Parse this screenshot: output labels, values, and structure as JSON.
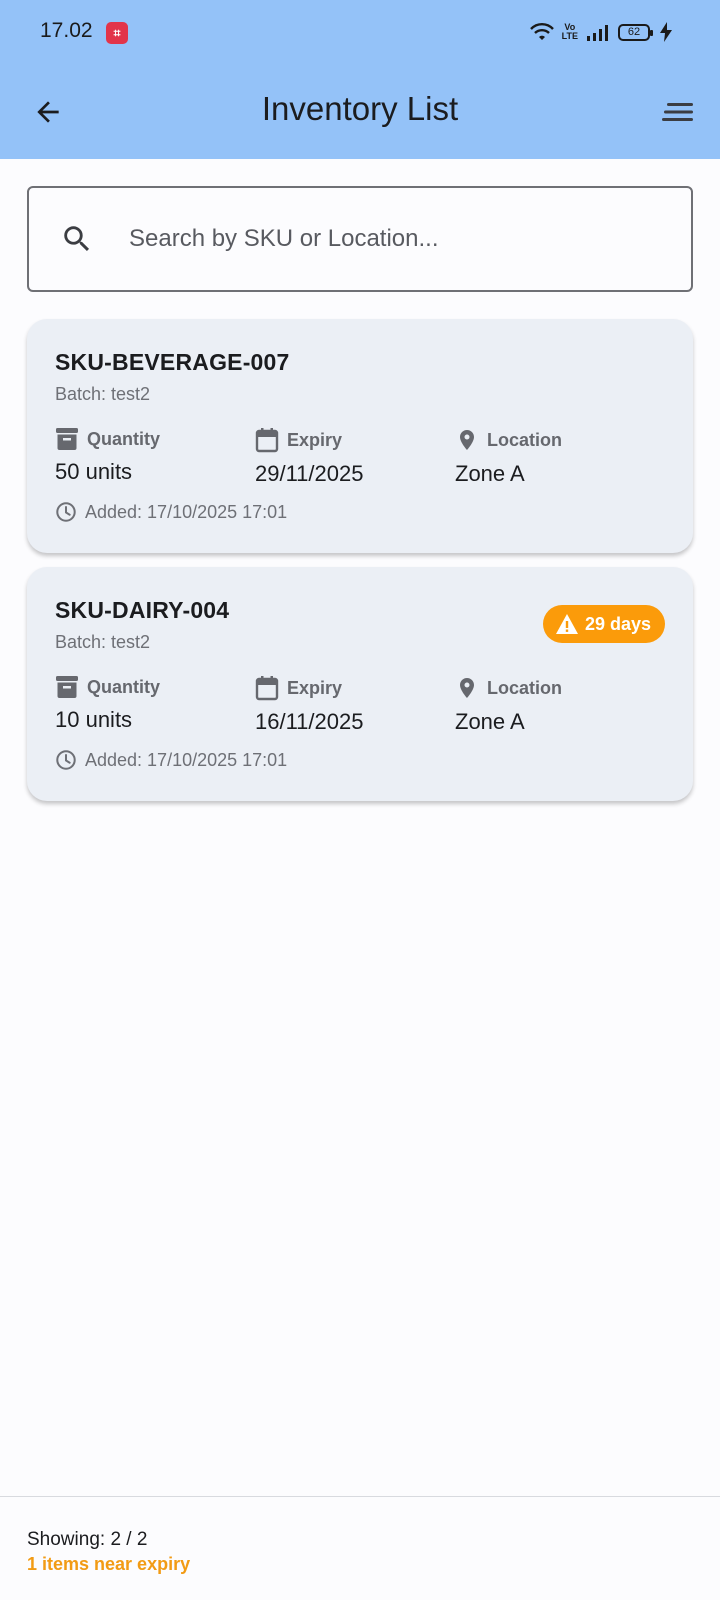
{
  "status_bar": {
    "time": "17.02",
    "battery": "62"
  },
  "app_bar": {
    "title": "Inventory List"
  },
  "search": {
    "placeholder": "Search by SKU or Location..."
  },
  "items": [
    {
      "sku": "SKU-BEVERAGE-007",
      "batch": "Batch: test2",
      "quantity_label": "Quantity",
      "quantity": "50 units",
      "expiry_label": "Expiry",
      "expiry": "29/11/2025",
      "location_label": "Location",
      "location": "Zone A",
      "added": "Added: 17/10/2025 17:01"
    },
    {
      "sku": "SKU-DAIRY-004",
      "batch": "Batch: test2",
      "badge": "29 days",
      "quantity_label": "Quantity",
      "quantity": "10 units",
      "expiry_label": "Expiry",
      "expiry": "16/11/2025",
      "location_label": "Location",
      "location": "Zone A",
      "added": "Added: 17/10/2025 17:01"
    }
  ],
  "footer": {
    "showing": "Showing: 2 / 2",
    "near_expiry": "1 items near expiry"
  },
  "colors": {
    "app_bar": "#94c2f8",
    "card": "#ebeff5",
    "warning": "#fb9b0a"
  },
  "icons": [
    "back-arrow-icon",
    "sort-icon",
    "search-icon",
    "archive-icon",
    "calendar-icon",
    "location-pin-icon",
    "clock-icon",
    "warning-icon",
    "wifi-icon",
    "signal-icon"
  ]
}
